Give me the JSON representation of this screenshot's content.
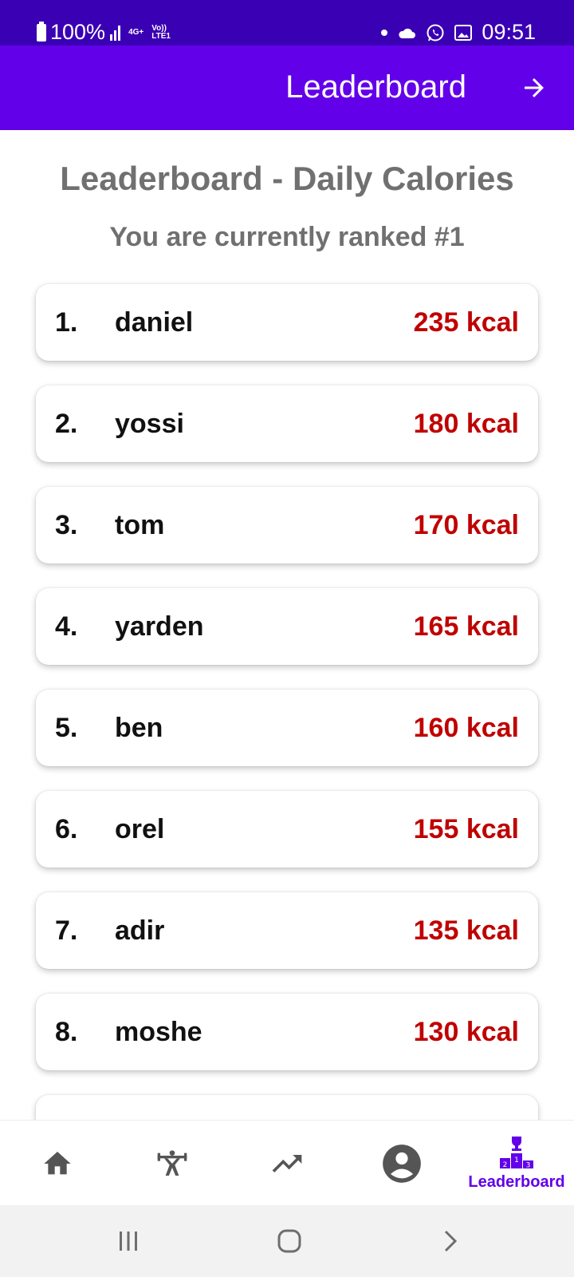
{
  "status_bar": {
    "battery": "100%",
    "network_top": "4G+",
    "network_bottom": "LTE1",
    "volte": "Vo))",
    "time": "09:51"
  },
  "app_bar": {
    "title": "Leaderboard"
  },
  "page": {
    "title": "Leaderboard - Daily Calories",
    "rank_message": "You are currently ranked #1"
  },
  "leaderboard": {
    "entries": [
      {
        "rank": "1.",
        "name": "daniel",
        "calories": "235 kcal"
      },
      {
        "rank": "2.",
        "name": "yossi",
        "calories": "180 kcal"
      },
      {
        "rank": "3.",
        "name": "tom",
        "calories": "170 kcal"
      },
      {
        "rank": "4.",
        "name": "yarden",
        "calories": "165 kcal"
      },
      {
        "rank": "5.",
        "name": "ben",
        "calories": "160 kcal"
      },
      {
        "rank": "6.",
        "name": "orel",
        "calories": "155 kcal"
      },
      {
        "rank": "7.",
        "name": "adir",
        "calories": "135 kcal"
      },
      {
        "rank": "8.",
        "name": "moshe",
        "calories": "130 kcal"
      }
    ]
  },
  "bottom_nav": {
    "items": [
      {
        "icon": "home-icon"
      },
      {
        "icon": "workout-icon"
      },
      {
        "icon": "trending-icon"
      },
      {
        "icon": "profile-icon"
      },
      {
        "icon": "podium-icon",
        "label": "Leaderboard"
      }
    ],
    "podium_numbers": [
      "2",
      "1",
      "3"
    ]
  },
  "colors": {
    "status_bar": "#3a00b3",
    "primary": "#6200ea",
    "calories": "#c00000",
    "heading": "#707070"
  }
}
